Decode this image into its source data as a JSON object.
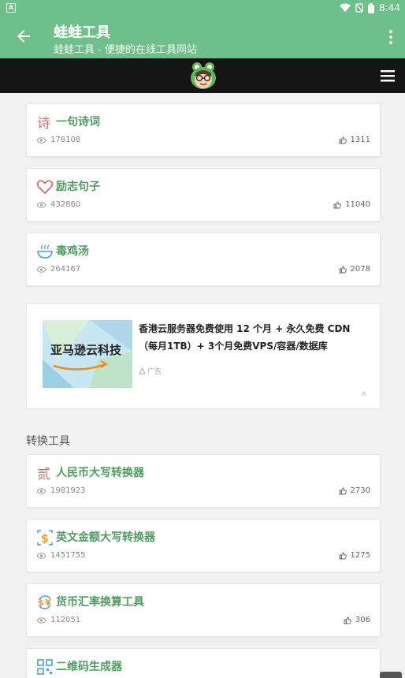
{
  "status_bar": {
    "time": "8:44",
    "indicator": "A"
  },
  "app_bar": {
    "title": "蛙蛙工具",
    "subtitle": "蛙蛙工具 - 便捷的在线工具网站"
  },
  "cards_top": [
    {
      "title": "一句诗词",
      "icon": "poem-icon",
      "views": "178108",
      "likes": "1311"
    },
    {
      "title": "励志句子",
      "icon": "heart-icon",
      "views": "432860",
      "likes": "11040"
    },
    {
      "title": "毒鸡汤",
      "icon": "soup-bowl-icon",
      "views": "264167",
      "likes": "2078"
    }
  ],
  "ad": {
    "image_text": "亚马逊云科技",
    "text": "香港云服务器免费使用 12 个月 + 永久免费 CDN （每月1TB）+ 3个月免费VPS/容器/数据库",
    "label": "广告",
    "close": "×"
  },
  "section": {
    "title": "转换工具"
  },
  "cards_bottom": [
    {
      "title": "人民币大写转换器",
      "icon": "rmb-char-icon",
      "views": "1981923",
      "likes": "2730"
    },
    {
      "title": "英文金额大写转换器",
      "icon": "dollar-icon",
      "views": "1451755",
      "likes": "1275"
    },
    {
      "title": "货币汇率换算工具",
      "icon": "currency-exchange-icon",
      "views": "112051",
      "likes": "306"
    },
    {
      "title": "二维码生成器",
      "icon": "qr-code-icon"
    }
  ],
  "colors": {
    "primary": "#6fbf8a",
    "title_green": "#4f9d5e",
    "header_dark": "#151515"
  }
}
